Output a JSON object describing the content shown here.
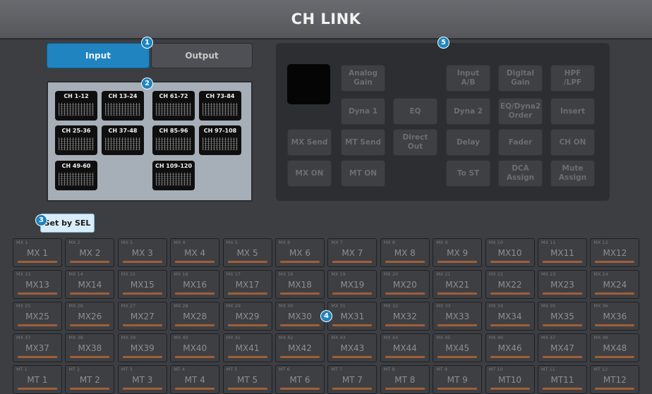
{
  "title": "CH LINK",
  "tabs": {
    "input": "Input",
    "output": "Output"
  },
  "ch_blocks": [
    {
      "label": "CH 1-12"
    },
    {
      "label": "CH 13-24"
    },
    {
      "label": "CH 61-72"
    },
    {
      "label": "CH 73-84"
    },
    {
      "label": "CH 25-36"
    },
    {
      "label": "CH 37-48"
    },
    {
      "label": "CH 85-96"
    },
    {
      "label": "CH 97-108"
    },
    {
      "label": "CH 49-60"
    },
    {
      "label": "CH 109-120"
    }
  ],
  "set_by_sel": "Set by SEL",
  "link_params": [
    {
      "label": "Analog\nGain"
    },
    {
      "label": "Input\nA/B"
    },
    {
      "label": "Digital\nGain"
    },
    {
      "label": "HPF\n/LPF"
    },
    {
      "label": "Dyna 1"
    },
    {
      "label": "EQ"
    },
    {
      "label": "Dyna 2"
    },
    {
      "label": "EQ/Dyna2\nOrder"
    },
    {
      "label": "Insert"
    },
    {
      "label": "MX Send"
    },
    {
      "label": "MT Send"
    },
    {
      "label": "Direct\nOut"
    },
    {
      "label": "Delay"
    },
    {
      "label": "Fader"
    },
    {
      "label": "CH ON"
    },
    {
      "label": "MX ON"
    },
    {
      "label": "MT ON"
    },
    {
      "label": "To ST"
    },
    {
      "label": "DCA\nAssign"
    },
    {
      "label": "Mute\nAssign"
    }
  ],
  "buses": [
    [
      {
        "small": "MX 1",
        "big": "MX 1"
      },
      {
        "small": "MX 2",
        "big": "MX 2"
      },
      {
        "small": "MX 3",
        "big": "MX 3"
      },
      {
        "small": "MX 4",
        "big": "MX 4"
      },
      {
        "small": "MX 5",
        "big": "MX 5"
      },
      {
        "small": "MX 6",
        "big": "MX 6"
      },
      {
        "small": "MX 7",
        "big": "MX 7"
      },
      {
        "small": "MX 8",
        "big": "MX 8"
      },
      {
        "small": "MX 9",
        "big": "MX 9"
      },
      {
        "small": "MX 10",
        "big": "MX10"
      },
      {
        "small": "MX 11",
        "big": "MX11"
      },
      {
        "small": "MX 12",
        "big": "MX12"
      }
    ],
    [
      {
        "small": "MX 13",
        "big": "MX13"
      },
      {
        "small": "MX 14",
        "big": "MX14"
      },
      {
        "small": "MX 15",
        "big": "MX15"
      },
      {
        "small": "MX 16",
        "big": "MX16"
      },
      {
        "small": "MX 17",
        "big": "MX17"
      },
      {
        "small": "MX 18",
        "big": "MX18"
      },
      {
        "small": "MX 19",
        "big": "MX19"
      },
      {
        "small": "MX 20",
        "big": "MX20"
      },
      {
        "small": "MX 21",
        "big": "MX21"
      },
      {
        "small": "MX 22",
        "big": "MX22"
      },
      {
        "small": "MX 23",
        "big": "MX23"
      },
      {
        "small": "MX 24",
        "big": "MX24"
      }
    ],
    [
      {
        "small": "MX 25",
        "big": "MX25"
      },
      {
        "small": "MX 26",
        "big": "MX26"
      },
      {
        "small": "MX 27",
        "big": "MX27"
      },
      {
        "small": "MX 28",
        "big": "MX28"
      },
      {
        "small": "MX 29",
        "big": "MX29"
      },
      {
        "small": "MX 30",
        "big": "MX30"
      },
      {
        "small": "MX 31",
        "big": "MX31"
      },
      {
        "small": "MX 32",
        "big": "MX32"
      },
      {
        "small": "MX 33",
        "big": "MX33"
      },
      {
        "small": "MX 34",
        "big": "MX34"
      },
      {
        "small": "MX 35",
        "big": "MX35"
      },
      {
        "small": "MX 36",
        "big": "MX36"
      }
    ],
    [
      {
        "small": "MX 37",
        "big": "MX37"
      },
      {
        "small": "MX 38",
        "big": "MX38"
      },
      {
        "small": "MX 39",
        "big": "MX39"
      },
      {
        "small": "MX 40",
        "big": "MX40"
      },
      {
        "small": "MX 41",
        "big": "MX41"
      },
      {
        "small": "MX 42",
        "big": "MX42"
      },
      {
        "small": "MX 43",
        "big": "MX43"
      },
      {
        "small": "MX 44",
        "big": "MX44"
      },
      {
        "small": "MX 45",
        "big": "MX45"
      },
      {
        "small": "MX 46",
        "big": "MX46"
      },
      {
        "small": "MX 47",
        "big": "MX47"
      },
      {
        "small": "MX 48",
        "big": "MX48"
      }
    ],
    [
      {
        "small": "MT 1",
        "big": "MT 1"
      },
      {
        "small": "MT 2",
        "big": "MT 2"
      },
      {
        "small": "MT 3",
        "big": "MT 3"
      },
      {
        "small": "MT 4",
        "big": "MT 4"
      },
      {
        "small": "MT 5",
        "big": "MT 5"
      },
      {
        "small": "MT 6",
        "big": "MT 6"
      },
      {
        "small": "MT 7",
        "big": "MT 7"
      },
      {
        "small": "MT 8",
        "big": "MT 8"
      },
      {
        "small": "MT 9",
        "big": "MT 9"
      },
      {
        "small": "MT 10",
        "big": "MT10"
      },
      {
        "small": "MT 11",
        "big": "MT11"
      },
      {
        "small": "MT 12",
        "big": "MT12"
      }
    ]
  ],
  "callouts": [
    "1",
    "2",
    "3",
    "4",
    "5"
  ],
  "colors": {
    "accent": "#1f84bf",
    "bus_bar": "#9e5f38",
    "background": "#3d3e42"
  }
}
